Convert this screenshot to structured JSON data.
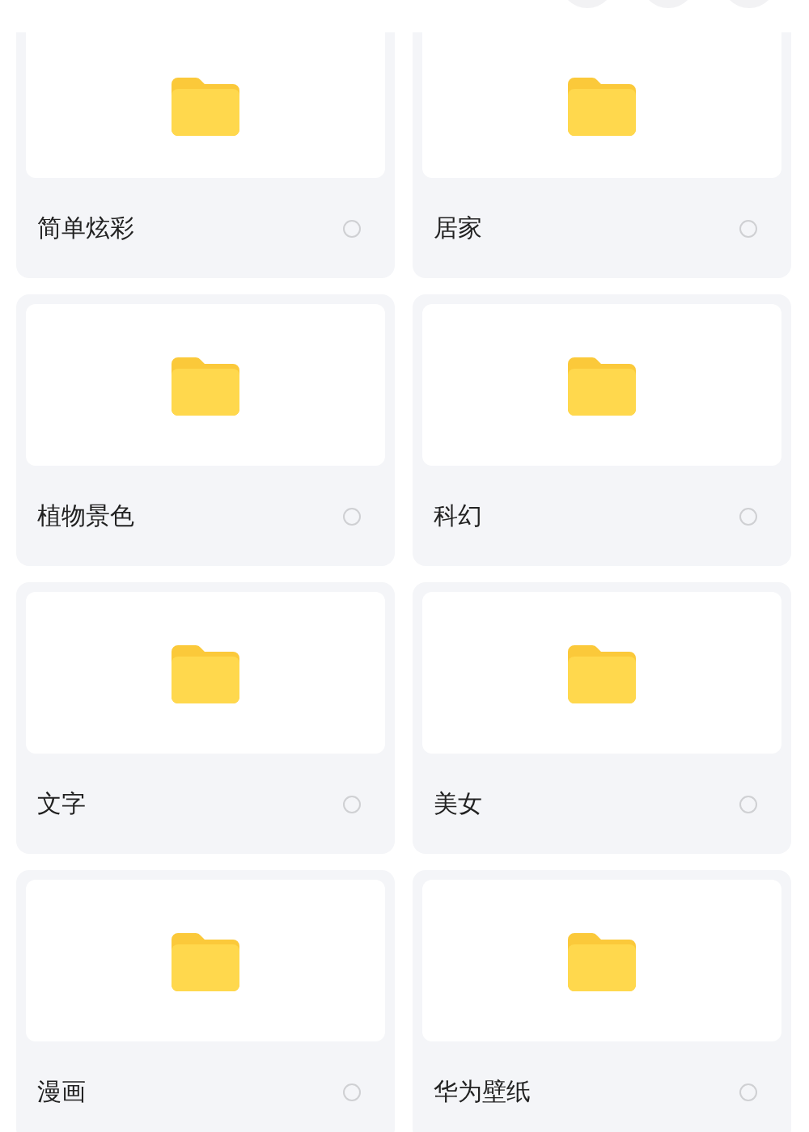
{
  "header": {
    "buttons": [
      {
        "kind": "round"
      },
      {
        "kind": "round"
      },
      {
        "kind": "round"
      }
    ]
  },
  "folders": [
    {
      "name": "简单炫彩",
      "selected": false
    },
    {
      "name": "居家",
      "selected": false
    },
    {
      "name": "植物景色",
      "selected": false
    },
    {
      "name": "科幻",
      "selected": false
    },
    {
      "name": "文字",
      "selected": false
    },
    {
      "name": "美女",
      "selected": false
    },
    {
      "name": "漫画",
      "selected": false
    },
    {
      "name": "华为壁纸",
      "selected": false
    }
  ]
}
